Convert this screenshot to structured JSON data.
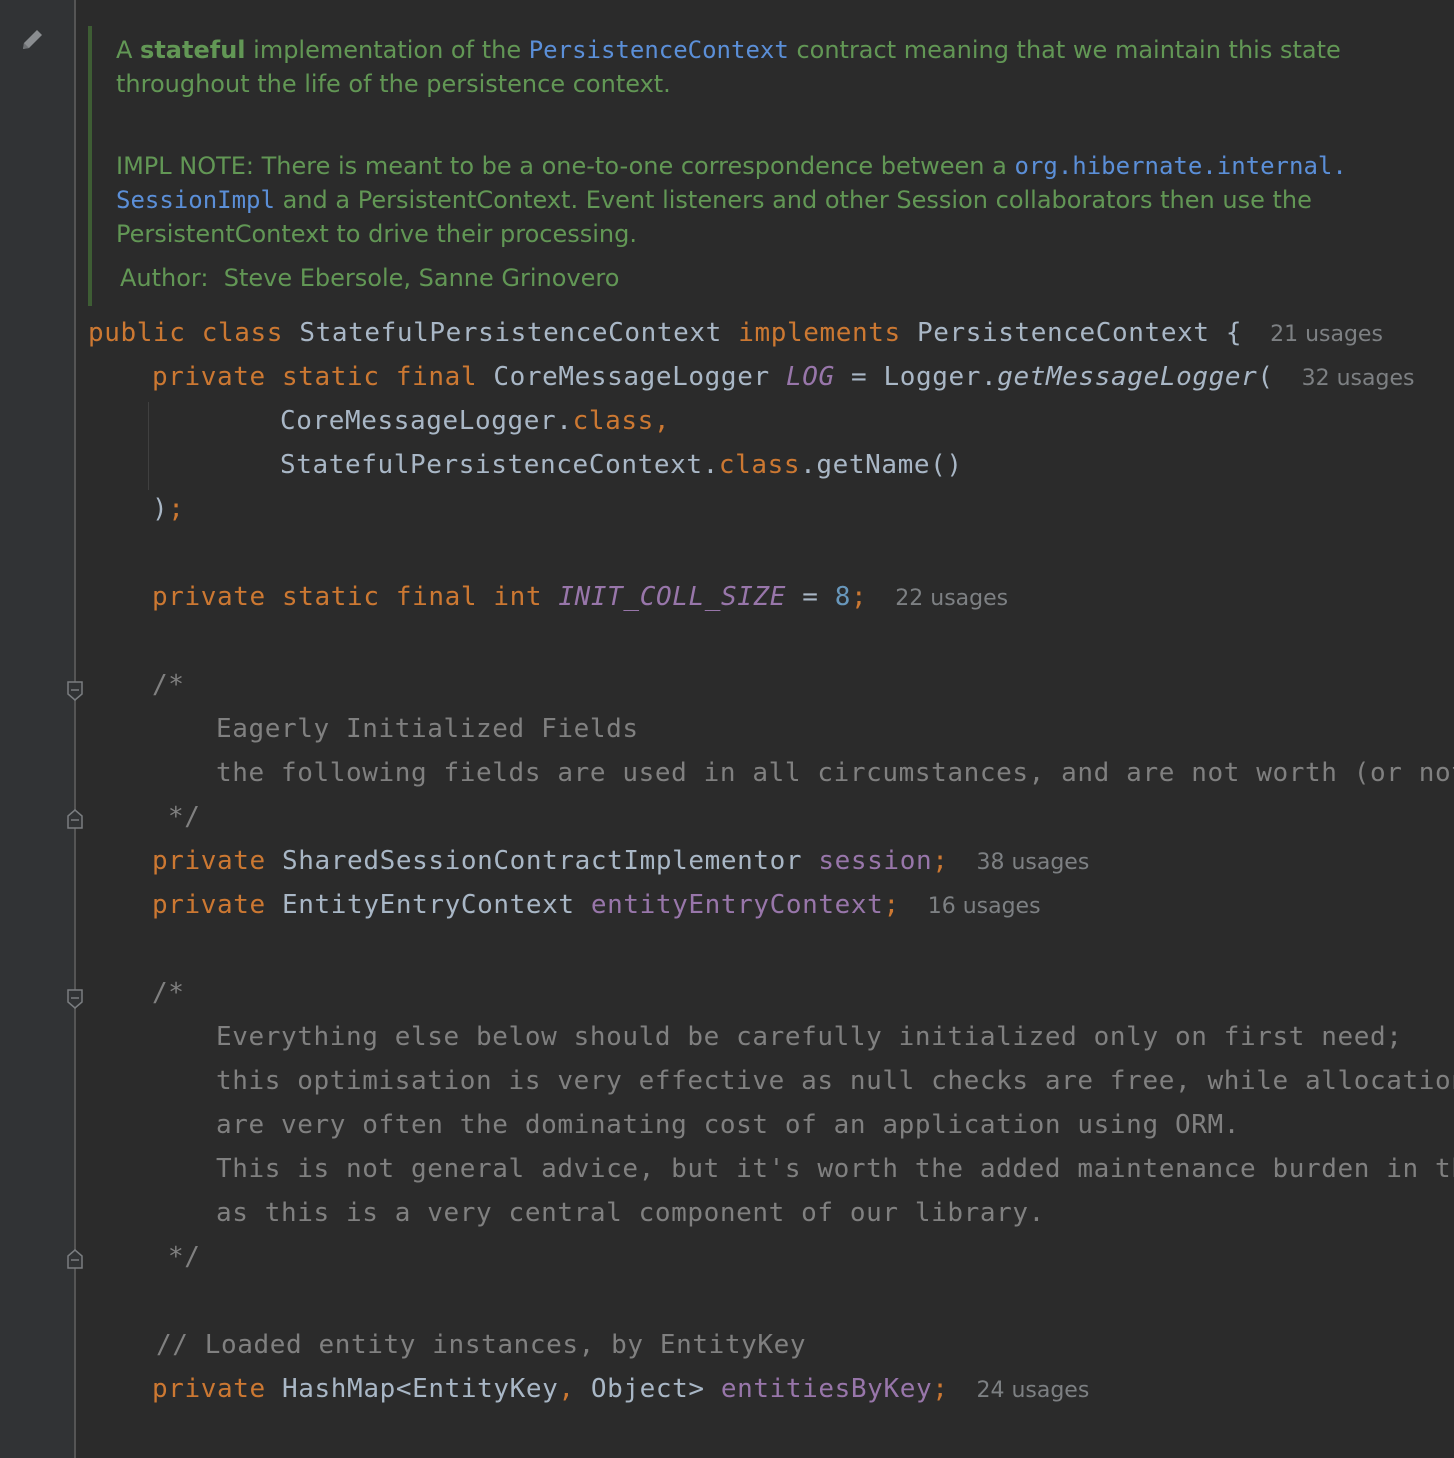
{
  "javadoc": {
    "p1_a": "A ",
    "p1_bold": "stateful",
    "p1_b": " implementation of the ",
    "p1_code": "PersistenceContext",
    "p1_c": " contract meaning that we maintain this state",
    "p1_line2": "throughout the life of the persistence context.",
    "p2_a": "IMPL NOTE: There is meant to be a one-to-one correspondence between a ",
    "p2_code1": "org.hibernate.internal.",
    "p2_code2": "SessionImpl",
    "p2_b": " and a PersistentContext. Event listeners and other Session collaborators then use the",
    "p2_line3": "PersistentContext to drive their processing.",
    "author_label": "Author:",
    "author_value": "Steve Ebersole, Sanne Grinovero"
  },
  "code": {
    "kw_public": "public",
    "kw_class": "class",
    "kw_implements": "implements",
    "kw_private": "private",
    "kw_static": "static",
    "kw_final": "final",
    "kw_int": "int",
    "kw_class_ref": "class",
    "class_name": "StatefulPersistenceContext",
    "interface_name": "PersistenceContext",
    "brace_open": " {",
    "class_usages": "21 usages",
    "logger_type": "CoreMessageLogger",
    "logger_field": "LOG",
    "logger_eq": " = Logger.",
    "logger_method": "getMessageLogger",
    "logger_paren": "(",
    "logger_usages": "32 usages",
    "arg1_type": "CoreMessageLogger.",
    "arg1_comma": ",",
    "arg2_type": "StatefulPersistenceContext.",
    "arg2_rest": ".getName()",
    "close_paren": ")",
    "semicolon": ";",
    "init_field": "INIT_COLL_SIZE",
    "init_eq": " = ",
    "init_value": "8",
    "init_usages": "22 usages",
    "c1_open": "/*",
    "c1_l1": "Eagerly Initialized Fields",
    "c1_l2": "the following fields are used in all circumstances, and are not worth (or not",
    "c1_close": "*/",
    "session_type": "SharedSessionContractImplementor",
    "session_field": "session",
    "session_usages": "38 usages",
    "eec_type": "EntityEntryContext",
    "eec_field": "entityEntryContext",
    "eec_usages": "16 usages",
    "c2_open": "/*",
    "c2_l1": "Everything else below should be carefully initialized only on first need;",
    "c2_l2": "this optimisation is very effective as null checks are free, while allocation",
    "c2_l3": "are very often the dominating cost of an application using ORM.",
    "c2_l4": "This is not general advice, but it's worth the added maintenance burden in thi",
    "c2_l5": "as this is a very central component of our library.",
    "c2_close": "*/",
    "line_comment": "// Loaded entity instances, by EntityKey",
    "map_type_a": "HashMap<EntityKey",
    "map_comma": ",",
    "map_type_b": " Object> ",
    "map_field": "entitiesByKey",
    "map_usages": "24 usages"
  },
  "icons": [
    "edit-pencil-icon",
    "fold-start-icon",
    "fold-end-icon"
  ],
  "colors": {
    "background": "#2b2b2b",
    "gutter": "#313335",
    "doc_text": "#629755",
    "keyword": "#cc7832",
    "field": "#9876aa",
    "number": "#6897bb",
    "comment": "#808080",
    "plain": "#a9b7c6"
  }
}
